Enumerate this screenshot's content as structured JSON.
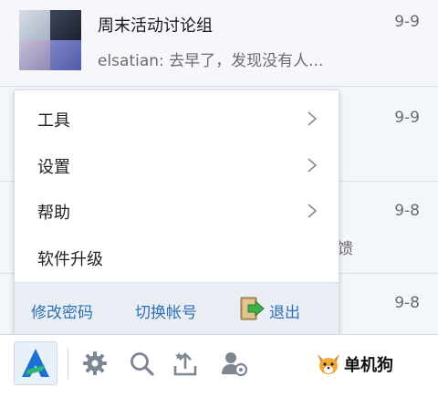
{
  "conversations": [
    {
      "name": "周末活动讨论组",
      "preview": "elsatian: 去早了，发现没有人...",
      "date": "9-9"
    },
    {
      "date": "9-9"
    },
    {
      "date": "9-8",
      "preview_tail": "馈"
    },
    {
      "date": "9-8"
    }
  ],
  "menu": {
    "items": [
      {
        "label": "工具",
        "has_submenu": true
      },
      {
        "label": "设置",
        "has_submenu": true
      },
      {
        "label": "帮助",
        "has_submenu": true
      },
      {
        "label": "软件升级",
        "has_submenu": false
      }
    ],
    "footer": {
      "change_password": "修改密码",
      "switch_account": "切换帐号",
      "exit": "退出"
    }
  },
  "bottom_bar": {
    "icons": [
      "app-logo-icon",
      "gear-icon",
      "search-icon",
      "upload-icon",
      "user-settings-icon"
    ],
    "brand": "单机狗"
  },
  "colors": {
    "accent": "#2f6fb5",
    "logo_blue": "#1d6fd8",
    "logo_green": "#2bb673",
    "menu_footer_bg": "#e9eef4"
  }
}
